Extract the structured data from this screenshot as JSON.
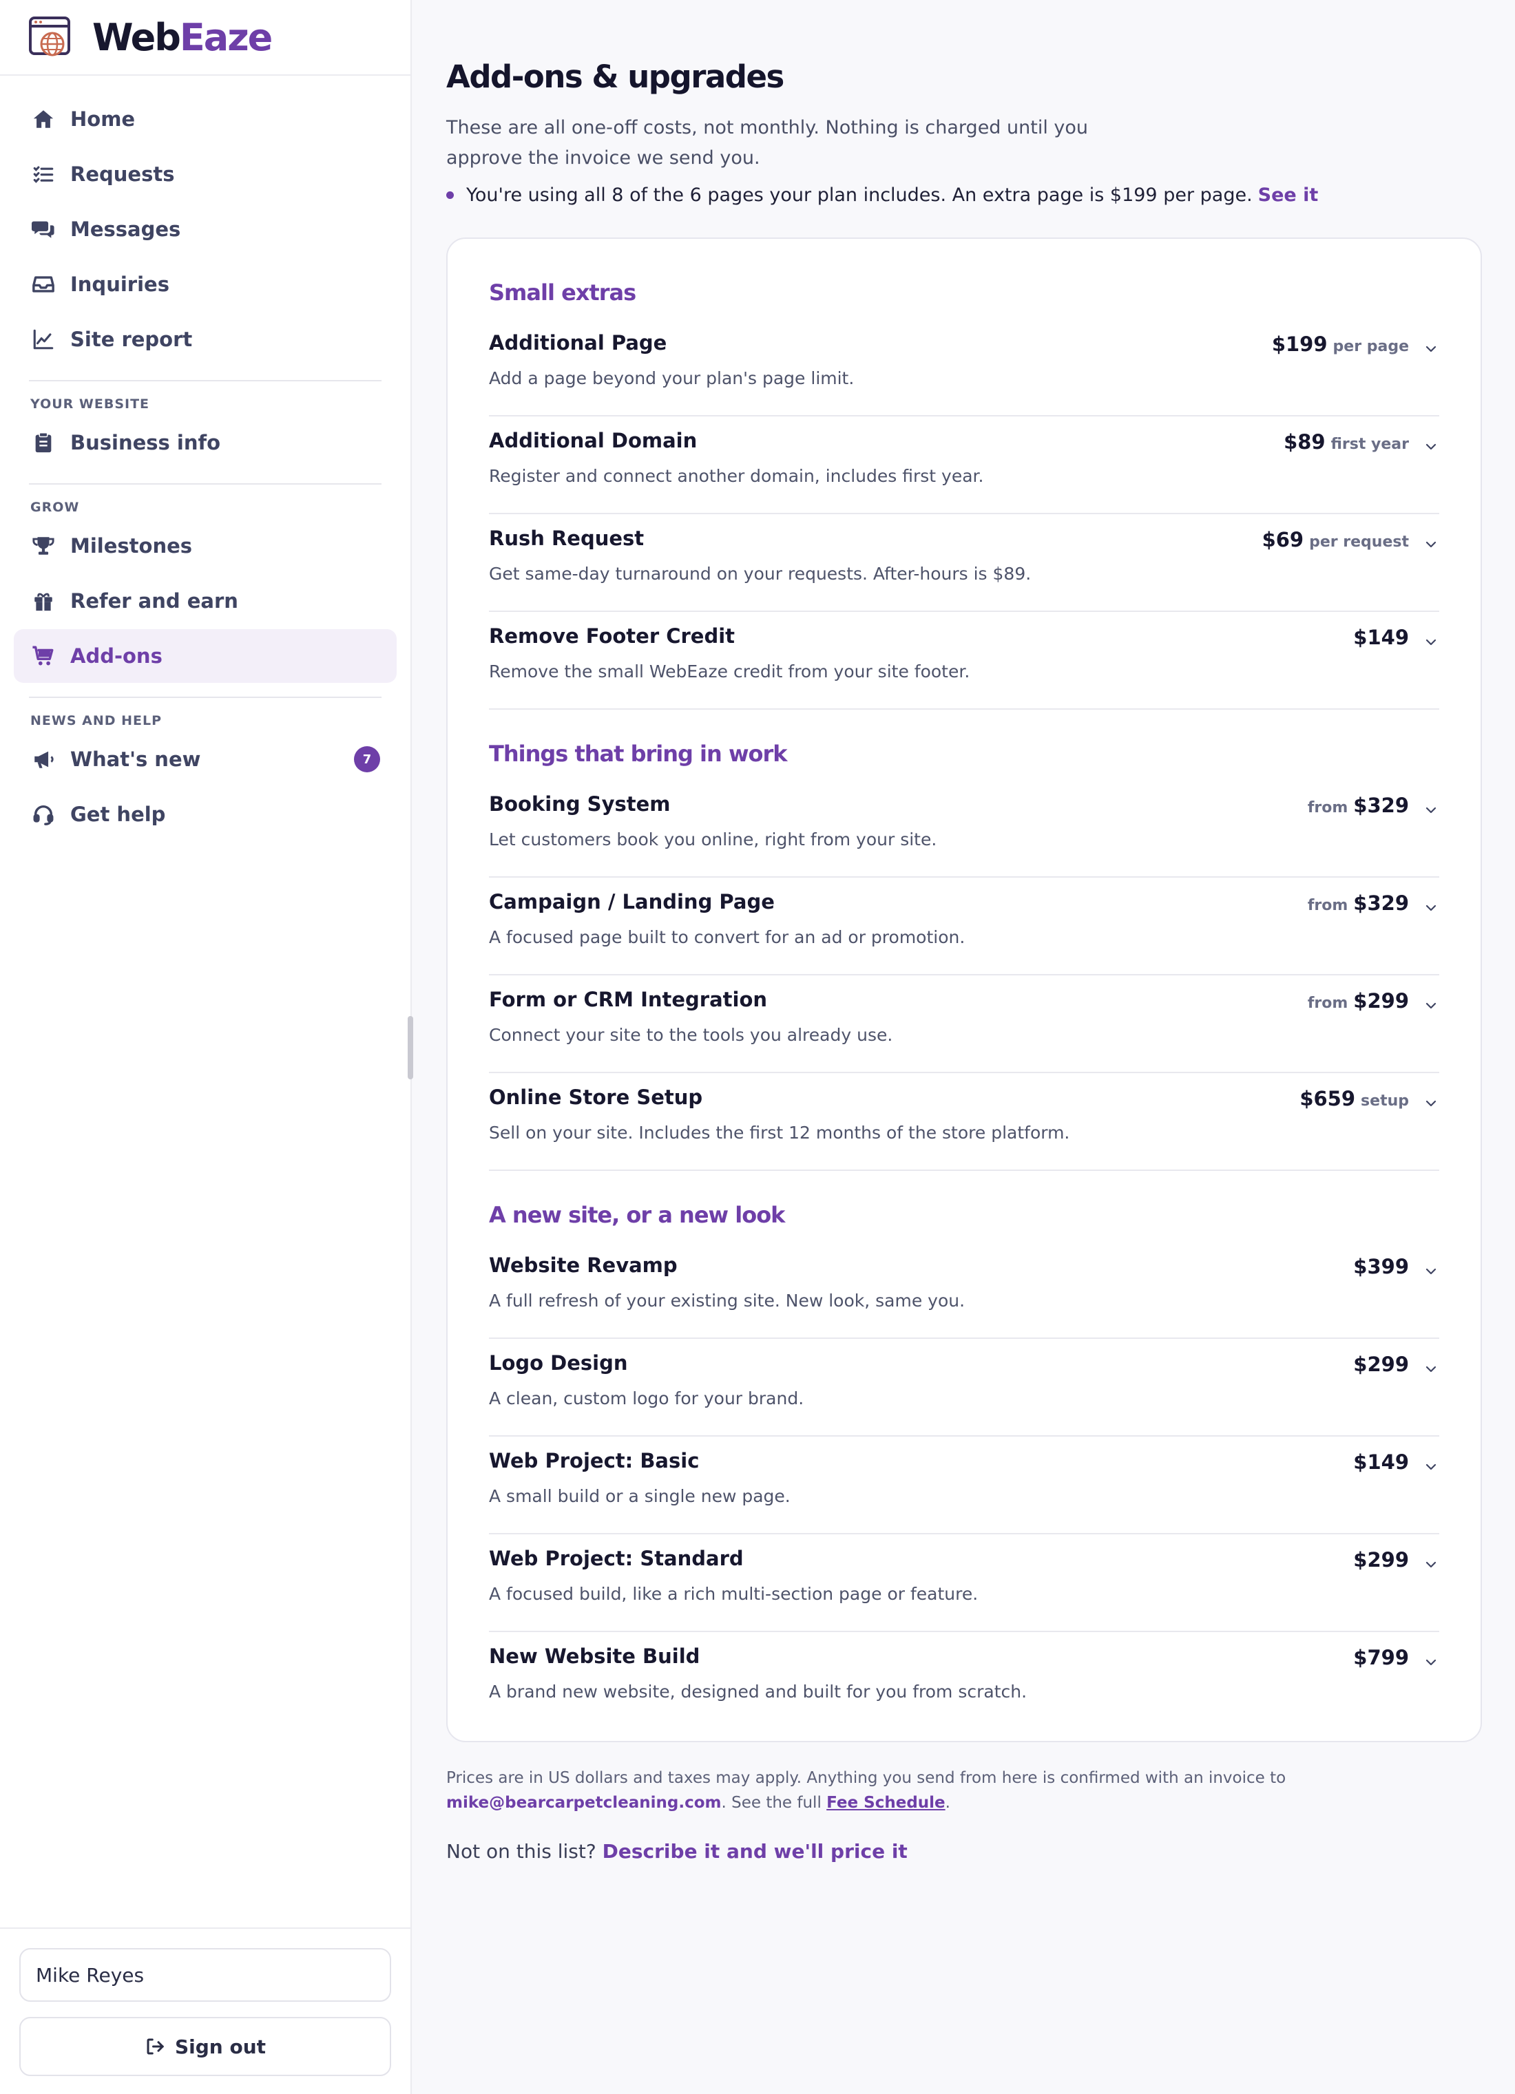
{
  "brand": {
    "name_part1": "Web",
    "name_part2": "Eaze"
  },
  "sidebar": {
    "main_items": [
      {
        "label": "Home",
        "icon": "home-icon"
      },
      {
        "label": "Requests",
        "icon": "checklist-icon"
      },
      {
        "label": "Messages",
        "icon": "chat-bubbles-icon"
      },
      {
        "label": "Inquiries",
        "icon": "inbox-icon"
      },
      {
        "label": "Site report",
        "icon": "line-chart-icon"
      }
    ],
    "sections": [
      {
        "title": "YOUR WEBSITE",
        "items": [
          {
            "label": "Business info",
            "icon": "clipboard-icon"
          }
        ]
      },
      {
        "title": "GROW",
        "items": [
          {
            "label": "Milestones",
            "icon": "trophy-icon"
          },
          {
            "label": "Refer and earn",
            "icon": "gift-icon"
          },
          {
            "label": "Add-ons",
            "icon": "cart-icon",
            "active": true
          }
        ]
      },
      {
        "title": "NEWS AND HELP",
        "items": [
          {
            "label": "What's new",
            "icon": "megaphone-icon",
            "badge": "7"
          },
          {
            "label": "Get help",
            "icon": "headset-icon"
          }
        ]
      }
    ],
    "user_name": "Mike Reyes",
    "sign_out_label": "Sign out"
  },
  "main": {
    "title": "Add-ons & upgrades",
    "intro": "These are all one-off costs, not monthly. Nothing is charged until you approve the invoice we send you.",
    "note_text": "You're using all 8 of the 6 pages your plan includes. An extra page is $199 per page.",
    "note_link": "See it",
    "groups": [
      {
        "title": "Small extras",
        "items": [
          {
            "name": "Additional Page",
            "desc": "Add a page beyond your plan's page limit.",
            "prefix": "",
            "price": "$199",
            "unit": "per page"
          },
          {
            "name": "Additional Domain",
            "desc": "Register and connect another domain, includes first year.",
            "prefix": "",
            "price": "$89",
            "unit": "first year"
          },
          {
            "name": "Rush Request",
            "desc": "Get same-day turnaround on your requests. After-hours is $89.",
            "prefix": "",
            "price": "$69",
            "unit": "per request"
          },
          {
            "name": "Remove Footer Credit",
            "desc": "Remove the small WebEaze credit from your site footer.",
            "prefix": "",
            "price": "$149",
            "unit": ""
          }
        ]
      },
      {
        "title": "Things that bring in work",
        "items": [
          {
            "name": "Booking System",
            "desc": "Let customers book you online, right from your site.",
            "prefix": "from",
            "price": "$329",
            "unit": ""
          },
          {
            "name": "Campaign / Landing Page",
            "desc": "A focused page built to convert for an ad or promotion.",
            "prefix": "from",
            "price": "$329",
            "unit": ""
          },
          {
            "name": "Form or CRM Integration",
            "desc": "Connect your site to the tools you already use.",
            "prefix": "from",
            "price": "$299",
            "unit": ""
          },
          {
            "name": "Online Store Setup",
            "desc": "Sell on your site. Includes the first 12 months of the store platform.",
            "prefix": "",
            "price": "$659",
            "unit": "setup"
          }
        ]
      },
      {
        "title": "A new site, or a new look",
        "items": [
          {
            "name": "Website Revamp",
            "desc": "A full refresh of your existing site. New look, same you.",
            "prefix": "",
            "price": "$399",
            "unit": ""
          },
          {
            "name": "Logo Design",
            "desc": "A clean, custom logo for your brand.",
            "prefix": "",
            "price": "$299",
            "unit": ""
          },
          {
            "name": "Web Project: Basic",
            "desc": "A small build or a single new page.",
            "prefix": "",
            "price": "$149",
            "unit": ""
          },
          {
            "name": "Web Project: Standard",
            "desc": "A focused build, like a rich multi-section page or feature.",
            "prefix": "",
            "price": "$299",
            "unit": ""
          },
          {
            "name": "New Website Build",
            "desc": "A brand new website, designed and built for you from scratch.",
            "prefix": "",
            "price": "$799",
            "unit": ""
          }
        ]
      }
    ],
    "footnote_part1": "Prices are in US dollars and taxes may apply. Anything you send from here is confirmed with an invoice to",
    "footnote_email": "mike@bearcarpetcleaning.com",
    "footnote_part2": ". See the full",
    "footnote_link": "Fee Schedule",
    "footnote_part3": ".",
    "cta_text": "Not on this list?",
    "cta_link": "Describe it and we'll price it"
  },
  "colors": {
    "accent": "#6e3fa8",
    "text_dark": "#17172e",
    "muted": "#4e536a",
    "background": "#f8f8fb"
  }
}
